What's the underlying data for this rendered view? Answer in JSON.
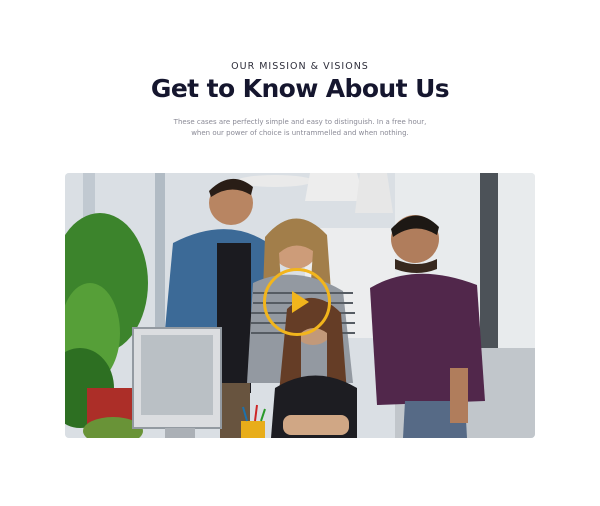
{
  "section": {
    "eyebrow": "OUR MISSION & VISIONS",
    "title": "Get to Know About Us",
    "description_lines": [
      "These cases are perfectly simple and easy to distinguish. In a free hour,",
      "when our power of choice is untrammelled and when nothing."
    ]
  },
  "video": {
    "play_icon": "play-icon",
    "accent_color": "#f2b51c"
  }
}
